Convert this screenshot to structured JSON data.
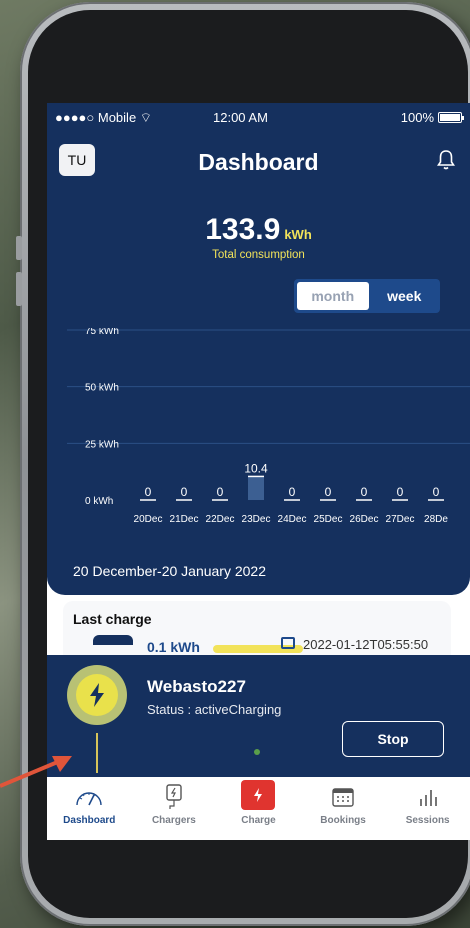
{
  "statusbar": {
    "carrier": "●●●●○ Mobile",
    "time": "12:00 AM",
    "battery": "100%"
  },
  "header": {
    "avatar": "TU",
    "title": "Dashboard"
  },
  "summary": {
    "value": "133.9",
    "unit": "kWh",
    "label": "Total consumption"
  },
  "toggle": {
    "month": "month",
    "week": "week",
    "selected": "week"
  },
  "chart_data": {
    "type": "bar",
    "categories": [
      "20Dec",
      "21Dec",
      "22Dec",
      "23Dec",
      "24Dec",
      "25Dec",
      "26Dec",
      "27Dec",
      "28De"
    ],
    "values": [
      0,
      0,
      0,
      10.4,
      0,
      0,
      0,
      0,
      0
    ],
    "value_labels": [
      "0",
      "0",
      "0",
      "10.4",
      "0",
      "0",
      "0",
      "0",
      "0"
    ],
    "ytick_labels": [
      "0 kWh",
      "25 kWh",
      "50 kWh",
      "75 kWh"
    ],
    "yticks": [
      0,
      25,
      50,
      75
    ],
    "ylim": [
      0,
      75
    ],
    "grid": true,
    "colors": {
      "bar": "#3c5f92",
      "bar_cap": "#ffffff",
      "grid": "#2b4f86"
    }
  },
  "range": "20 December-20 January 2022",
  "last_charge": {
    "heading": "Last charge",
    "energy": "0.1 kWh",
    "date": "2022-01-12T05:55:50"
  },
  "session": {
    "station": "Webasto227",
    "status": "Status : activeCharging",
    "stop_label": "Stop"
  },
  "tabs": [
    {
      "label": "Dashboard",
      "icon": "gauge-icon",
      "active": true
    },
    {
      "label": "Chargers",
      "icon": "charger-icon",
      "active": false
    },
    {
      "label": "Charge",
      "icon": "bolt-icon",
      "active": false
    },
    {
      "label": "Bookings",
      "icon": "calendar-icon",
      "active": false
    },
    {
      "label": "Sessions",
      "icon": "bar-chart-icon",
      "active": false
    }
  ],
  "colors": {
    "primary": "#15305e",
    "accent": "#f2e35a",
    "danger": "#e0342f"
  }
}
